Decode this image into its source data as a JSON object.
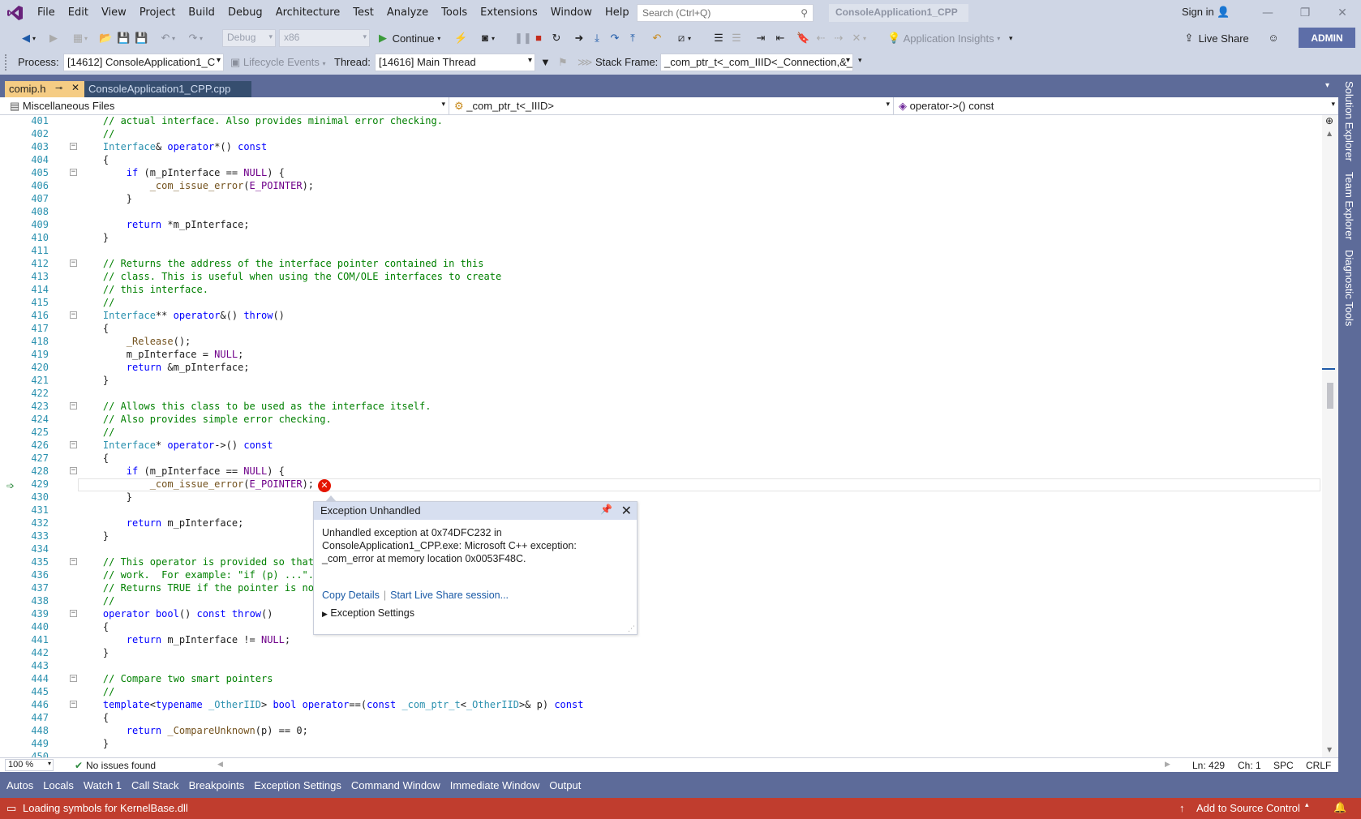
{
  "menu": {
    "items": [
      "File",
      "Edit",
      "View",
      "Project",
      "Build",
      "Debug",
      "Architecture",
      "Test",
      "Analyze",
      "Tools",
      "Extensions",
      "Window",
      "Help"
    ],
    "search_placeholder": "Search (Ctrl+Q)",
    "project_title": "ConsoleApplication1_CPP",
    "sign_in": "Sign in"
  },
  "toolbar": {
    "config": "Debug",
    "platform": "x86",
    "continue_label": "Continue",
    "app_insights": "Application Insights",
    "live_share": "Live Share",
    "admin": "ADMIN"
  },
  "location": {
    "process_label": "Process:",
    "process_value": "[14612] ConsoleApplication1_C",
    "lifecycle": "Lifecycle Events",
    "thread_label": "Thread:",
    "thread_value": "[14616] Main Thread",
    "stack_label": "Stack Frame:",
    "stack_value": "_com_ptr_t<_com_IIID<_Connection,&_"
  },
  "tabs": {
    "active": "comip.h",
    "second": "ConsoleApplication1_CPP.cpp"
  },
  "nav": {
    "project": "Miscellaneous Files",
    "scope": "_com_ptr_t<_IIID>",
    "member": "operator->() const"
  },
  "code_lines": [
    {
      "n": "401",
      "t": "    // actual interface. Also provides minimal error checking."
    },
    {
      "n": "402",
      "t": "    //"
    },
    {
      "n": "403",
      "t": "    Interface& operator*() const"
    },
    {
      "n": "404",
      "t": "    {"
    },
    {
      "n": "405",
      "t": "        if (m_pInterface == NULL) {"
    },
    {
      "n": "406",
      "t": "            _com_issue_error(E_POINTER);"
    },
    {
      "n": "407",
      "t": "        }"
    },
    {
      "n": "408",
      "t": ""
    },
    {
      "n": "409",
      "t": "        return *m_pInterface;"
    },
    {
      "n": "410",
      "t": "    }"
    },
    {
      "n": "411",
      "t": ""
    },
    {
      "n": "412",
      "t": "    // Returns the address of the interface pointer contained in this"
    },
    {
      "n": "413",
      "t": "    // class. This is useful when using the COM/OLE interfaces to create"
    },
    {
      "n": "414",
      "t": "    // this interface."
    },
    {
      "n": "415",
      "t": "    //"
    },
    {
      "n": "416",
      "t": "    Interface** operator&() throw()"
    },
    {
      "n": "417",
      "t": "    {"
    },
    {
      "n": "418",
      "t": "        _Release();"
    },
    {
      "n": "419",
      "t": "        m_pInterface = NULL;"
    },
    {
      "n": "420",
      "t": "        return &m_pInterface;"
    },
    {
      "n": "421",
      "t": "    }"
    },
    {
      "n": "422",
      "t": ""
    },
    {
      "n": "423",
      "t": "    // Allows this class to be used as the interface itself."
    },
    {
      "n": "424",
      "t": "    // Also provides simple error checking."
    },
    {
      "n": "425",
      "t": "    //"
    },
    {
      "n": "426",
      "t": "    Interface* operator->() const"
    },
    {
      "n": "427",
      "t": "    {"
    },
    {
      "n": "428",
      "t": "        if (m_pInterface == NULL) {"
    },
    {
      "n": "429",
      "t": "            _com_issue_error(E_POINTER);"
    },
    {
      "n": "430",
      "t": "        }"
    },
    {
      "n": "431",
      "t": ""
    },
    {
      "n": "432",
      "t": "        return m_pInterface;"
    },
    {
      "n": "433",
      "t": "    }"
    },
    {
      "n": "434",
      "t": ""
    },
    {
      "n": "435",
      "t": "    // This operator is provided so that"
    },
    {
      "n": "436",
      "t": "    // work.  For example: \"if (p) ...\"."
    },
    {
      "n": "437",
      "t": "    // Returns TRUE if the pointer is not"
    },
    {
      "n": "438",
      "t": "    //"
    },
    {
      "n": "439",
      "t": "    operator bool() const throw()"
    },
    {
      "n": "440",
      "t": "    {"
    },
    {
      "n": "441",
      "t": "        return m_pInterface != NULL;"
    },
    {
      "n": "442",
      "t": "    }"
    },
    {
      "n": "443",
      "t": ""
    },
    {
      "n": "444",
      "t": "    // Compare two smart pointers"
    },
    {
      "n": "445",
      "t": "    //"
    },
    {
      "n": "446",
      "t": "    template<typename _OtherIID> bool operator==(const _com_ptr_t<_OtherIID>& p) const"
    },
    {
      "n": "447",
      "t": "    {"
    },
    {
      "n": "448",
      "t": "        return _CompareUnknown(p) == 0;"
    },
    {
      "n": "449",
      "t": "    }"
    },
    {
      "n": "450",
      "t": ""
    }
  ],
  "exception": {
    "title": "Exception Unhandled",
    "line1": "Unhandled exception at 0x74DFC232 in",
    "line2": "ConsoleApplication1_CPP.exe: Microsoft C++ exception:",
    "line3": "_com_error at memory location 0x0053F48C.",
    "copy_details": "Copy Details",
    "live_share": "Start Live Share session...",
    "settings": "Exception Settings"
  },
  "editor_status": {
    "zoom": "100 %",
    "issues": "No issues found",
    "ln": "Ln: 429",
    "ch": "Ch: 1",
    "spc": "SPC",
    "crlf": "CRLF"
  },
  "tool_tabs": [
    "Autos",
    "Locals",
    "Watch 1",
    "Call Stack",
    "Breakpoints",
    "Exception Settings",
    "Command Window",
    "Immediate Window",
    "Output"
  ],
  "status": {
    "message": "Loading symbols for KernelBase.dll",
    "source_control": "Add to Source Control"
  },
  "side_tabs": [
    "Solution Explorer",
    "Team Explorer",
    "Diagnostic Tools"
  ],
  "colors": {
    "accent": "#5d6b99",
    "status_bar": "#c03d2e",
    "tab_active": "#f5cc84"
  }
}
